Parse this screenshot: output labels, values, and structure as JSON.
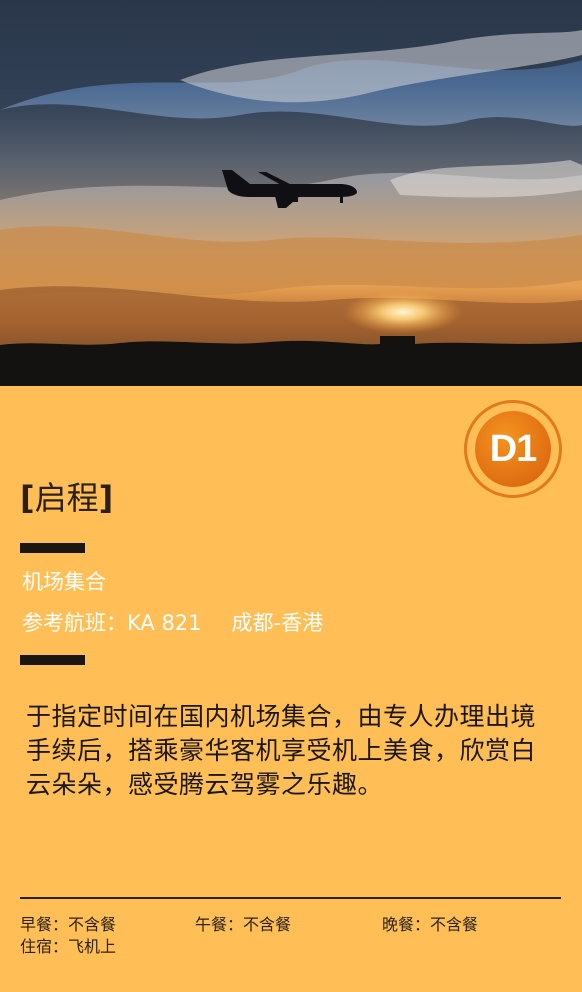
{
  "badge": {
    "label": "D1"
  },
  "title": {
    "open": "[",
    "text": "启程",
    "close": "]"
  },
  "meta": {
    "gather": "机场集合",
    "flight": "参考航班：KA 821",
    "route": "成都-香港"
  },
  "description": "于指定时间在国内机场集合，由专人办理出境手续后，搭乘豪华客机享受机上美食，欣赏白云朵朵，感受腾云驾雾之乐趣。",
  "footer": {
    "breakfast": "早餐：不含餐",
    "lunch": "午餐：不含餐",
    "dinner": "晚餐：不含餐",
    "stay": "住宿：飞机上"
  },
  "colors": {
    "background": "#ffbf56",
    "badge_fill": "#e06e12",
    "badge_ring": "#e07a1f",
    "meta_text": "#ffffff",
    "bar": "#1a1611"
  }
}
